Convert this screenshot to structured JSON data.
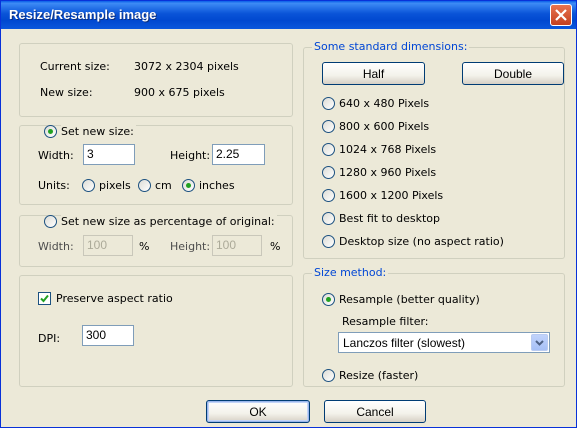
{
  "window": {
    "title": "Resize/Resample image"
  },
  "info": {
    "current_label": "Current size:",
    "current_value": "3072  x  2304  pixels",
    "new_label": "New size:",
    "new_value": "900  x  675  pixels"
  },
  "set_new_size": {
    "label": "Set new size:",
    "selected": true,
    "width_label": "Width:",
    "width_value": "3",
    "height_label": "Height:",
    "height_value": "2.25",
    "units_label": "Units:",
    "units": [
      "pixels",
      "cm",
      "inches"
    ],
    "selected_unit": "inches"
  },
  "percentage": {
    "label": "Set new size as percentage of original:",
    "selected": false,
    "width_label": "Width:",
    "width_value": "100",
    "height_label": "Height:",
    "height_value": "100",
    "percent_symbol": "%"
  },
  "aspect": {
    "preserve_label": "Preserve aspect ratio",
    "preserve_checked": true,
    "dpi_label": "DPI:",
    "dpi_value": "300"
  },
  "standard": {
    "legend": "Some standard dimensions:",
    "half_label": "Half",
    "double_label": "Double",
    "options": [
      "640 x 480 Pixels",
      "800 x 600 Pixels",
      "1024 x 768 Pixels",
      "1280 x 960 Pixels",
      "1600 x 1200 Pixels",
      "Best fit to desktop",
      "Desktop size (no aspect ratio)"
    ]
  },
  "method": {
    "legend": "Size method:",
    "resample_label": "Resample (better quality)",
    "resample_selected": true,
    "filter_label": "Resample filter:",
    "filter_value": "Lanczos filter (slowest)",
    "resize_label": "Resize (faster)",
    "resize_selected": false
  },
  "buttons": {
    "ok": "OK",
    "cancel": "Cancel"
  },
  "colors": {
    "title_bar": "#0054e3",
    "group_legend": "#0046d5",
    "dialog_bg": "#ece9d8",
    "close_button": "#d9532c"
  }
}
